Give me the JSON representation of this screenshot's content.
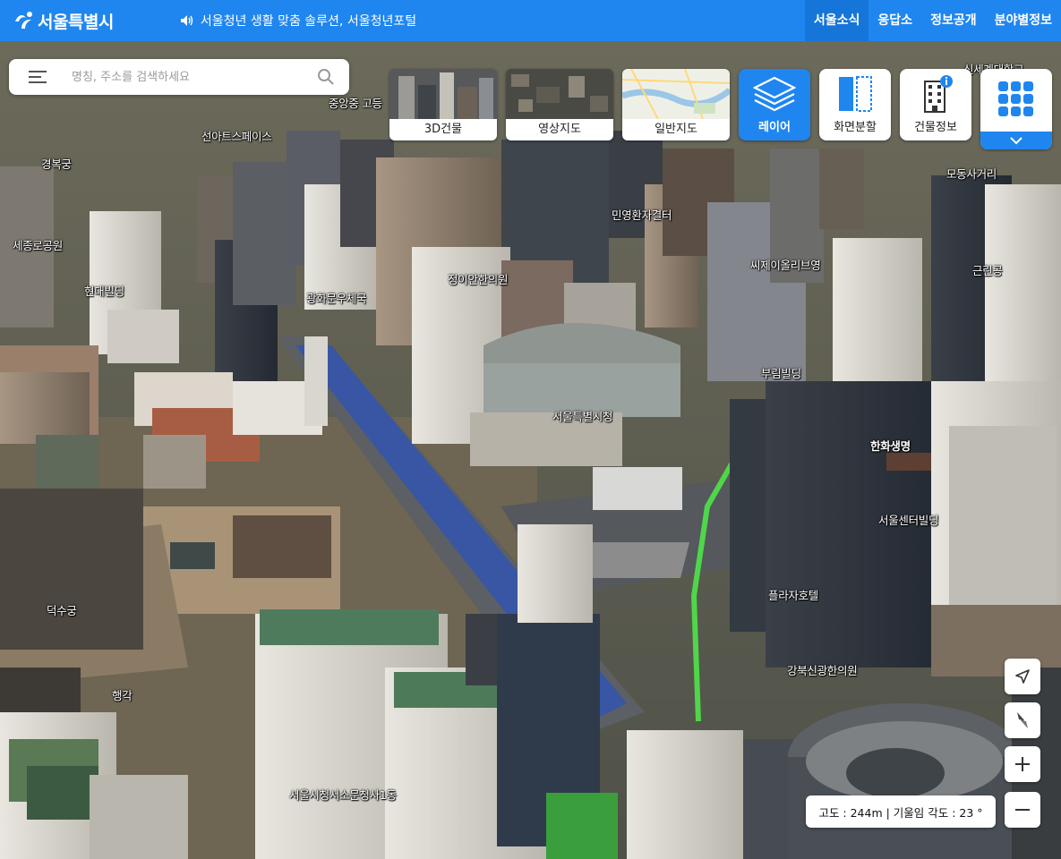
{
  "header": {
    "logo_text": "서울특별시",
    "notice_text": "서울청년 생활 맞춤 솔루션, 서울청년포털",
    "nav": [
      "서울소식",
      "응답소",
      "정보공개",
      "분야별정보"
    ],
    "brand_color": "#1f86f0"
  },
  "search": {
    "placeholder": "명칭, 주소를 검색하세요"
  },
  "map_types": [
    "3D건물",
    "영상지도",
    "일반지도"
  ],
  "tools": {
    "layer": "레이어",
    "split": "화면분할",
    "building_info": "건물정보"
  },
  "status": {
    "text": "고도 : 244m | 기울임 각도 : 23 °"
  },
  "map_labels": [
    "서울시청서소문청사1동",
    "중앙중 고등",
    "선아트스페이스",
    "경복궁",
    "세종로공원",
    "현대빌딩",
    "광화문우체국",
    "정이안한의원",
    "민영환자결터",
    "씨제이올리브영",
    "부림빌딩",
    "서울특별시청",
    "서울센터빌딩",
    "플라자호텔",
    "강북신광한의원",
    "덕수궁",
    "행각",
    "모동사거리",
    "근린공",
    "신세계대학교",
    "한화생명"
  ],
  "icons": {
    "menu": "hamburger-icon",
    "search": "search-icon",
    "speaker": "speaker-icon",
    "layers": "layers-icon",
    "split": "split-screen-icon",
    "building": "building-info-icon",
    "apps": "apps-grid-icon",
    "chevron": "chevron-down-icon",
    "navigate": "navigation-arrow-icon",
    "compass": "compass-icon",
    "zoom_in": "plus-icon",
    "zoom_out": "minus-icon"
  }
}
